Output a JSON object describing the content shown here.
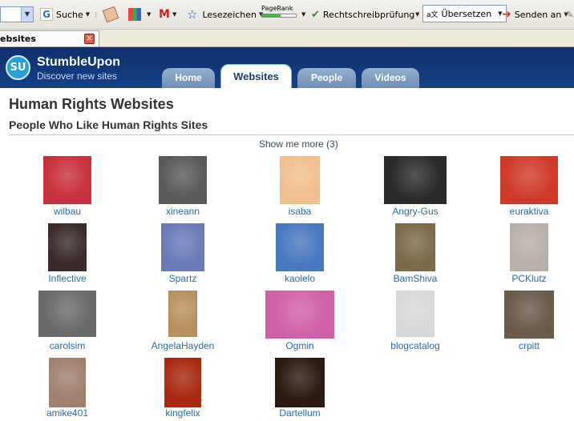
{
  "toolbar": {
    "suche": "Suche",
    "lesezeichen": "Lesezeichen",
    "pagerank": "PageRank",
    "rechtschreibpruefung": "Rechtschreibprüfung",
    "uebersetzen": "Übersetzen",
    "senden": "Senden an"
  },
  "browser_tab": {
    "label": "ebsites"
  },
  "header": {
    "logo_mark": "SU",
    "brand": "StumbleUpon",
    "tagline": "Discover new sites",
    "tabs": [
      "Home",
      "Websites",
      "People",
      "Videos"
    ],
    "active_tab": "Websites"
  },
  "main": {
    "title": "Human Rights Websites",
    "subtitle": "People Who Like Human Rights Sites",
    "show_more": "Show me more (3)"
  },
  "users": [
    {
      "name": "wilbau",
      "color": "#c8303c"
    },
    {
      "name": "xineann",
      "color": "#5a5a5a"
    },
    {
      "name": "isaba",
      "color": "#f0c090"
    },
    {
      "name": "Angry-Gus",
      "color": "#2a2a2a"
    },
    {
      "name": "euraktiva",
      "color": "#d03a2a"
    },
    {
      "name": "Inflective",
      "color": "#3a2a2a"
    },
    {
      "name": "Spartz",
      "color": "#6a7ab8"
    },
    {
      "name": "kaolelo",
      "color": "#4a78c0"
    },
    {
      "name": "BamShiva",
      "color": "#7a6a4a"
    },
    {
      "name": "PCKlutz",
      "color": "#b8b0a8"
    },
    {
      "name": "carolsim",
      "color": "#6a6a6a"
    },
    {
      "name": "AngelaHayden",
      "color": "#b89060"
    },
    {
      "name": "Ogmin",
      "color": "#d060a8"
    },
    {
      "name": "blogcatalog",
      "color": "#d8d8d8"
    },
    {
      "name": "crpitt",
      "color": "#6a5a4a"
    },
    {
      "name": "amike401",
      "color": "#a08070"
    },
    {
      "name": "kingfelix",
      "color": "#a82810"
    },
    {
      "name": "Dartellum",
      "color": "#2a1a10"
    }
  ],
  "colors": {
    "header_bg": "#144187",
    "link": "#2c6aa3",
    "tab": "#7f9fc1"
  }
}
